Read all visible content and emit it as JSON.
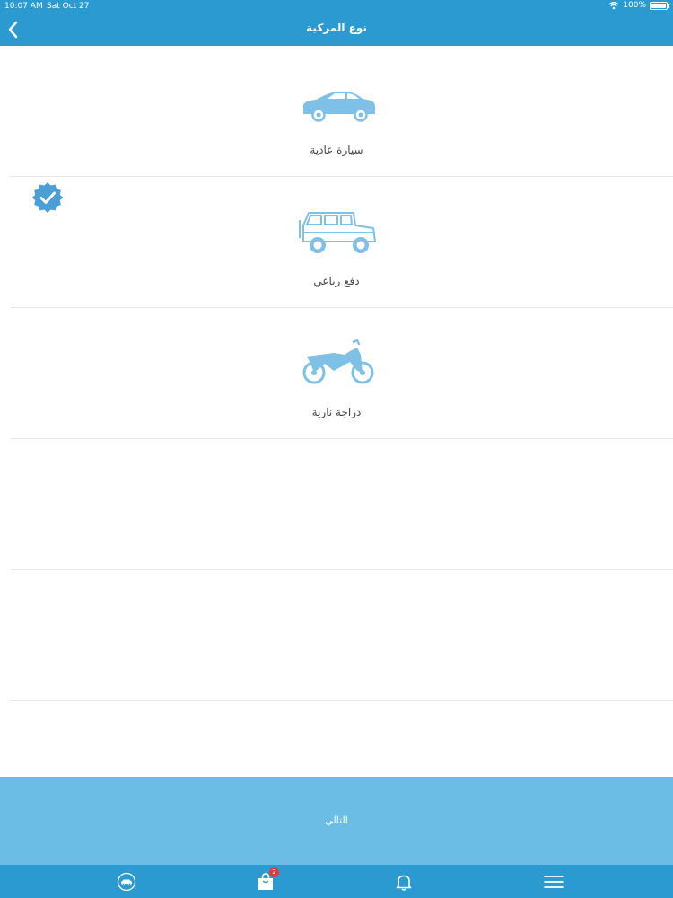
{
  "status_bar": {
    "time": "10:07 AM",
    "date": "Sat Oct 27",
    "battery": "100%"
  },
  "header": {
    "title": "نوع المركبة"
  },
  "vehicles": [
    {
      "label": "سيارة عادية",
      "icon": "sedan-car-icon",
      "selected": false
    },
    {
      "label": "دفع رباعي",
      "icon": "jeep-4x4-icon",
      "selected": true
    },
    {
      "label": "دراجة نارية",
      "icon": "motorcycle-icon",
      "selected": false
    }
  ],
  "next_button": {
    "label": "التالي"
  },
  "tabbar": {
    "items": [
      {
        "icon": "car-logo-icon"
      },
      {
        "icon": "shopping-bag-icon",
        "badge": "2"
      },
      {
        "icon": "bell-icon"
      },
      {
        "icon": "menu-icon"
      }
    ]
  },
  "colors": {
    "primary": "#2b9ad1",
    "accent_light": "#6bbde6",
    "icon_blue": "#7fc0e6"
  }
}
